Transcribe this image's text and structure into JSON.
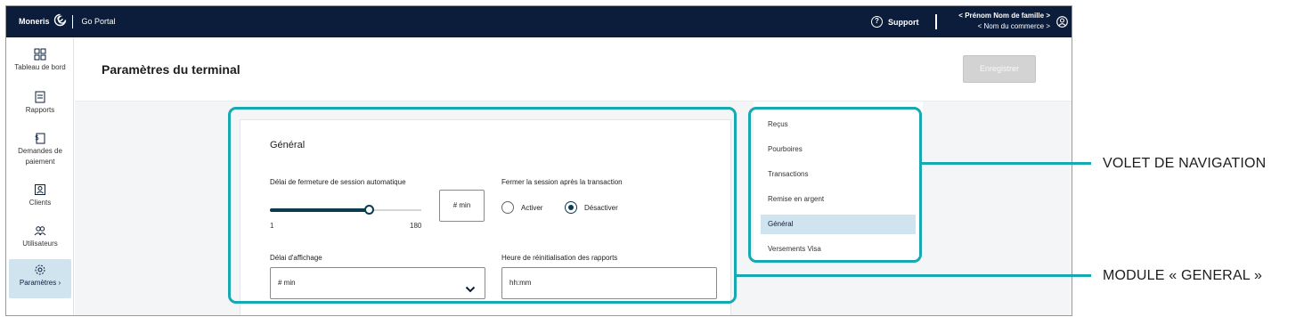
{
  "topbar": {
    "brand": "Moneris",
    "portal": "Go Portal",
    "support": "Support",
    "user_name": "< Prénom Nom de famille >",
    "merchant_name": "< Nom du commerce >"
  },
  "sidebar": {
    "items": [
      {
        "label": "Tableau de bord",
        "icon": "dashboard-icon"
      },
      {
        "label": "Rapports",
        "icon": "report-icon"
      },
      {
        "label": "Demandes de paiement",
        "icon": "payment-request-icon"
      },
      {
        "label": "Clients",
        "icon": "client-icon"
      },
      {
        "label": "Utilisateurs",
        "icon": "users-icon"
      },
      {
        "label": "Paramètres ›",
        "icon": "gear-icon",
        "active": true
      }
    ]
  },
  "header": {
    "title": "Paramètres du terminal",
    "save_label": "Enregistrer"
  },
  "general": {
    "title": "Général",
    "auto_logout_label": "Délai de fermeture de session automatique",
    "slider_min": "1",
    "slider_max": "180",
    "slider_value_fraction": 0.65,
    "min_box": "# min",
    "close_session_label": "Fermer la session après la transaction",
    "radio_on": "Activer",
    "radio_off": "Désactiver",
    "radio_selected": "Désactiver",
    "display_delay_label": "Délai d'affichage",
    "display_delay_value": "# min",
    "report_reset_label": "Heure de réinitialisation des rapports",
    "report_reset_value": "hh:mm"
  },
  "sidenav": {
    "items": [
      {
        "label": "Reçus"
      },
      {
        "label": "Pourboires"
      },
      {
        "label": "Transactions"
      },
      {
        "label": "Remise en argent"
      },
      {
        "label": "Général",
        "active": true
      },
      {
        "label": "Versements Visa"
      }
    ]
  },
  "callouts": {
    "nav": "VOLET DE NAVIGATION",
    "module": "MODULE « GENERAL »"
  },
  "colors": {
    "topbar": "#0b1d3b",
    "accent": "#17a9b1",
    "active_bg": "#cfe4ef"
  }
}
